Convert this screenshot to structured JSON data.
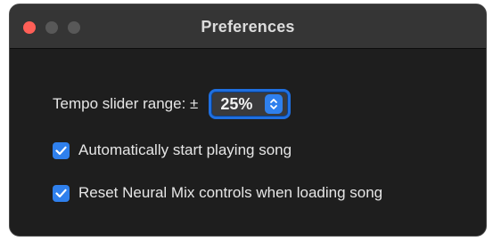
{
  "window": {
    "title": "Preferences"
  },
  "tempo": {
    "label": "Tempo slider range: ±",
    "value": "25%"
  },
  "options": [
    {
      "label": "Automatically start playing song",
      "checked": true
    },
    {
      "label": "Reset Neural Mix controls when loading song",
      "checked": true
    }
  ],
  "icons": {
    "close": "close-icon",
    "minimize": "minimize-icon",
    "zoom": "zoom-icon",
    "stepper": "chevron-up-down-icon",
    "check": "checkmark-icon"
  },
  "colors": {
    "accent": "#2f80ed",
    "close": "#ff5f57",
    "inactive_traffic": "#585858",
    "window_bg": "#1e1e1e",
    "titlebar_bg": "#353535"
  }
}
